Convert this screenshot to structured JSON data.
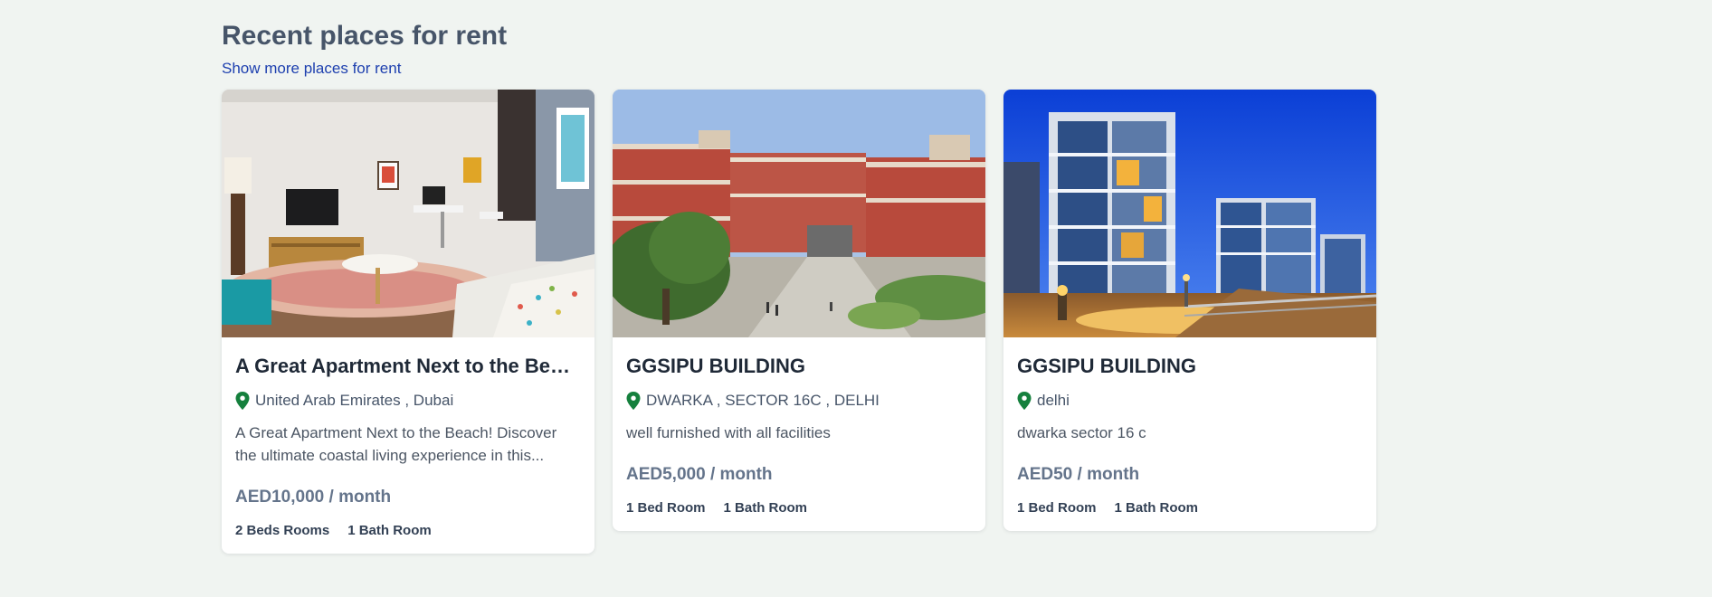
{
  "section": {
    "title": "Recent places for rent",
    "more_link": "Show more places for rent"
  },
  "listings": [
    {
      "image_subject": "apartment-living-room",
      "title": "A Great Apartment Next to the Beach",
      "location": "United Arab Emirates , Dubai",
      "description": "A Great Apartment Next to the Beach! Discover the ultimate coastal living experience in this...",
      "price": "AED10,000 / month",
      "beds": "2 Beds Rooms",
      "baths": "1 Bath Room"
    },
    {
      "image_subject": "university-campus-building",
      "title": "GGSIPU BUILDING",
      "location": "DWARKA , SECTOR 16C , DELHI",
      "description": "well furnished with all facilities",
      "price": "AED5,000 / month",
      "beds": "1 Bed Room",
      "baths": "1 Bath Room"
    },
    {
      "image_subject": "modern-apartment-block-at-dusk",
      "title": "GGSIPU BUILDING",
      "location": "delhi",
      "description": "dwarka sector 16 c",
      "price": "AED50 / month",
      "beds": "1 Bed Room",
      "baths": "1 Bath Room"
    }
  ],
  "colors": {
    "background": "#f0f4f1",
    "link": "#1e40af",
    "pin": "#15803d",
    "price": "#64748b"
  },
  "icons": {
    "location": "map-pin-icon"
  }
}
